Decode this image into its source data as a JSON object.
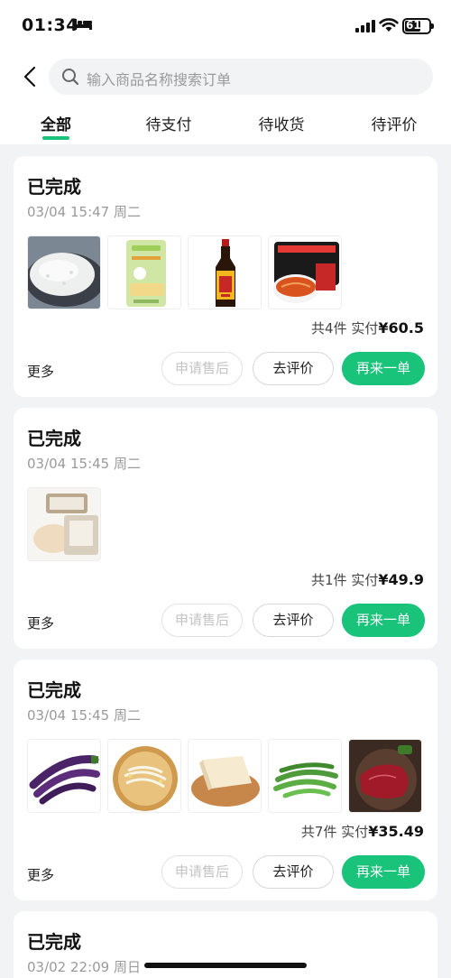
{
  "status_bar": {
    "time": "01:34",
    "battery": "61"
  },
  "search": {
    "placeholder": "输入商品名称搜索订单"
  },
  "tabs": [
    {
      "label": "全部",
      "active": true
    },
    {
      "label": "待支付",
      "active": false
    },
    {
      "label": "待收货",
      "active": false
    },
    {
      "label": "待评价",
      "active": false
    }
  ],
  "orders": [
    {
      "status": "已完成",
      "datetime": "03/04 15:47 周二",
      "items": [
        "rice",
        "cat-litter",
        "soy-sauce",
        "instant-noodles"
      ],
      "count_label": "共4件",
      "paid_label": "实付",
      "amount": "¥60.5",
      "more": "更多",
      "buttons": {
        "after_sale": "申请售后",
        "review": "去评价",
        "reorder": "再来一单"
      }
    },
    {
      "status": "已完成",
      "datetime": "03/04 15:45 周二",
      "items": [
        "powder-compact"
      ],
      "count_label": "共1件",
      "paid_label": "实付",
      "amount": "¥49.9",
      "more": "更多",
      "buttons": {
        "after_sale": "申请售后",
        "review": "去评价",
        "reorder": "再来一单"
      }
    },
    {
      "status": "已完成",
      "datetime": "03/04 15:45 周二",
      "items": [
        "eggplant",
        "bean-sprouts",
        "tofu",
        "green-beans",
        "beef"
      ],
      "count_label": "共7件",
      "paid_label": "实付",
      "amount": "¥35.49",
      "more": "更多",
      "buttons": {
        "after_sale": "申请售后",
        "review": "去评价",
        "reorder": "再来一单"
      }
    },
    {
      "status": "已完成",
      "datetime": "03/02 22:09 周日"
    }
  ],
  "colors": {
    "accent": "#19c37a",
    "background": "#f2f3f5"
  }
}
